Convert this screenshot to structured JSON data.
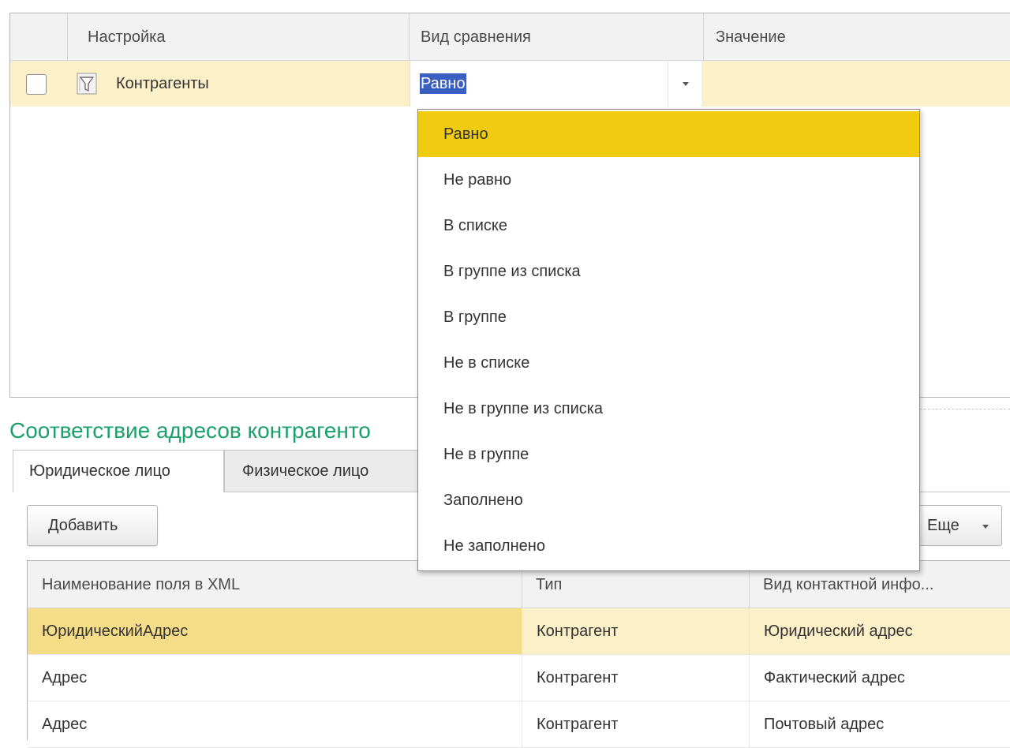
{
  "filter_table": {
    "columns": [
      "Настройка",
      "Вид сравнения",
      "Значение"
    ],
    "row": {
      "checked": false,
      "icon": "filter-icon",
      "name": "Контрагенты",
      "comparison": "Равно",
      "value": ""
    }
  },
  "dropdown": {
    "selected": "Равно",
    "options": [
      "Равно",
      "Не равно",
      "В списке",
      "В группе из списка",
      "В группе",
      "Не в списке",
      "Не в группе из списка",
      "Не в группе",
      "Заполнено",
      "Не заполнено"
    ]
  },
  "section": {
    "title": "Соответствие адресов контрагенто"
  },
  "tabs": [
    {
      "label": "Юридическое лицо",
      "active": true
    },
    {
      "label": "Физическое лицо",
      "active": false
    }
  ],
  "toolbar": {
    "add_label": "Добавить",
    "more_label": "Еще"
  },
  "address_table": {
    "columns": [
      "Наименование поля в XML",
      "Тип",
      "Вид контактной инфо..."
    ],
    "rows": [
      [
        "ЮридическийАдрес",
        "Контрагент",
        "Юридический адрес"
      ],
      [
        "Адрес",
        "Контрагент",
        "Фактический адрес"
      ],
      [
        "Адрес",
        "Контрагент",
        "Почтовый адрес"
      ]
    ]
  },
  "colors": {
    "selection_yellow": "#f0cb0f",
    "row_highlight": "#fbf0c8",
    "section_title_green": "#1aa06b",
    "text_selection_blue": "#3b5fc0"
  }
}
